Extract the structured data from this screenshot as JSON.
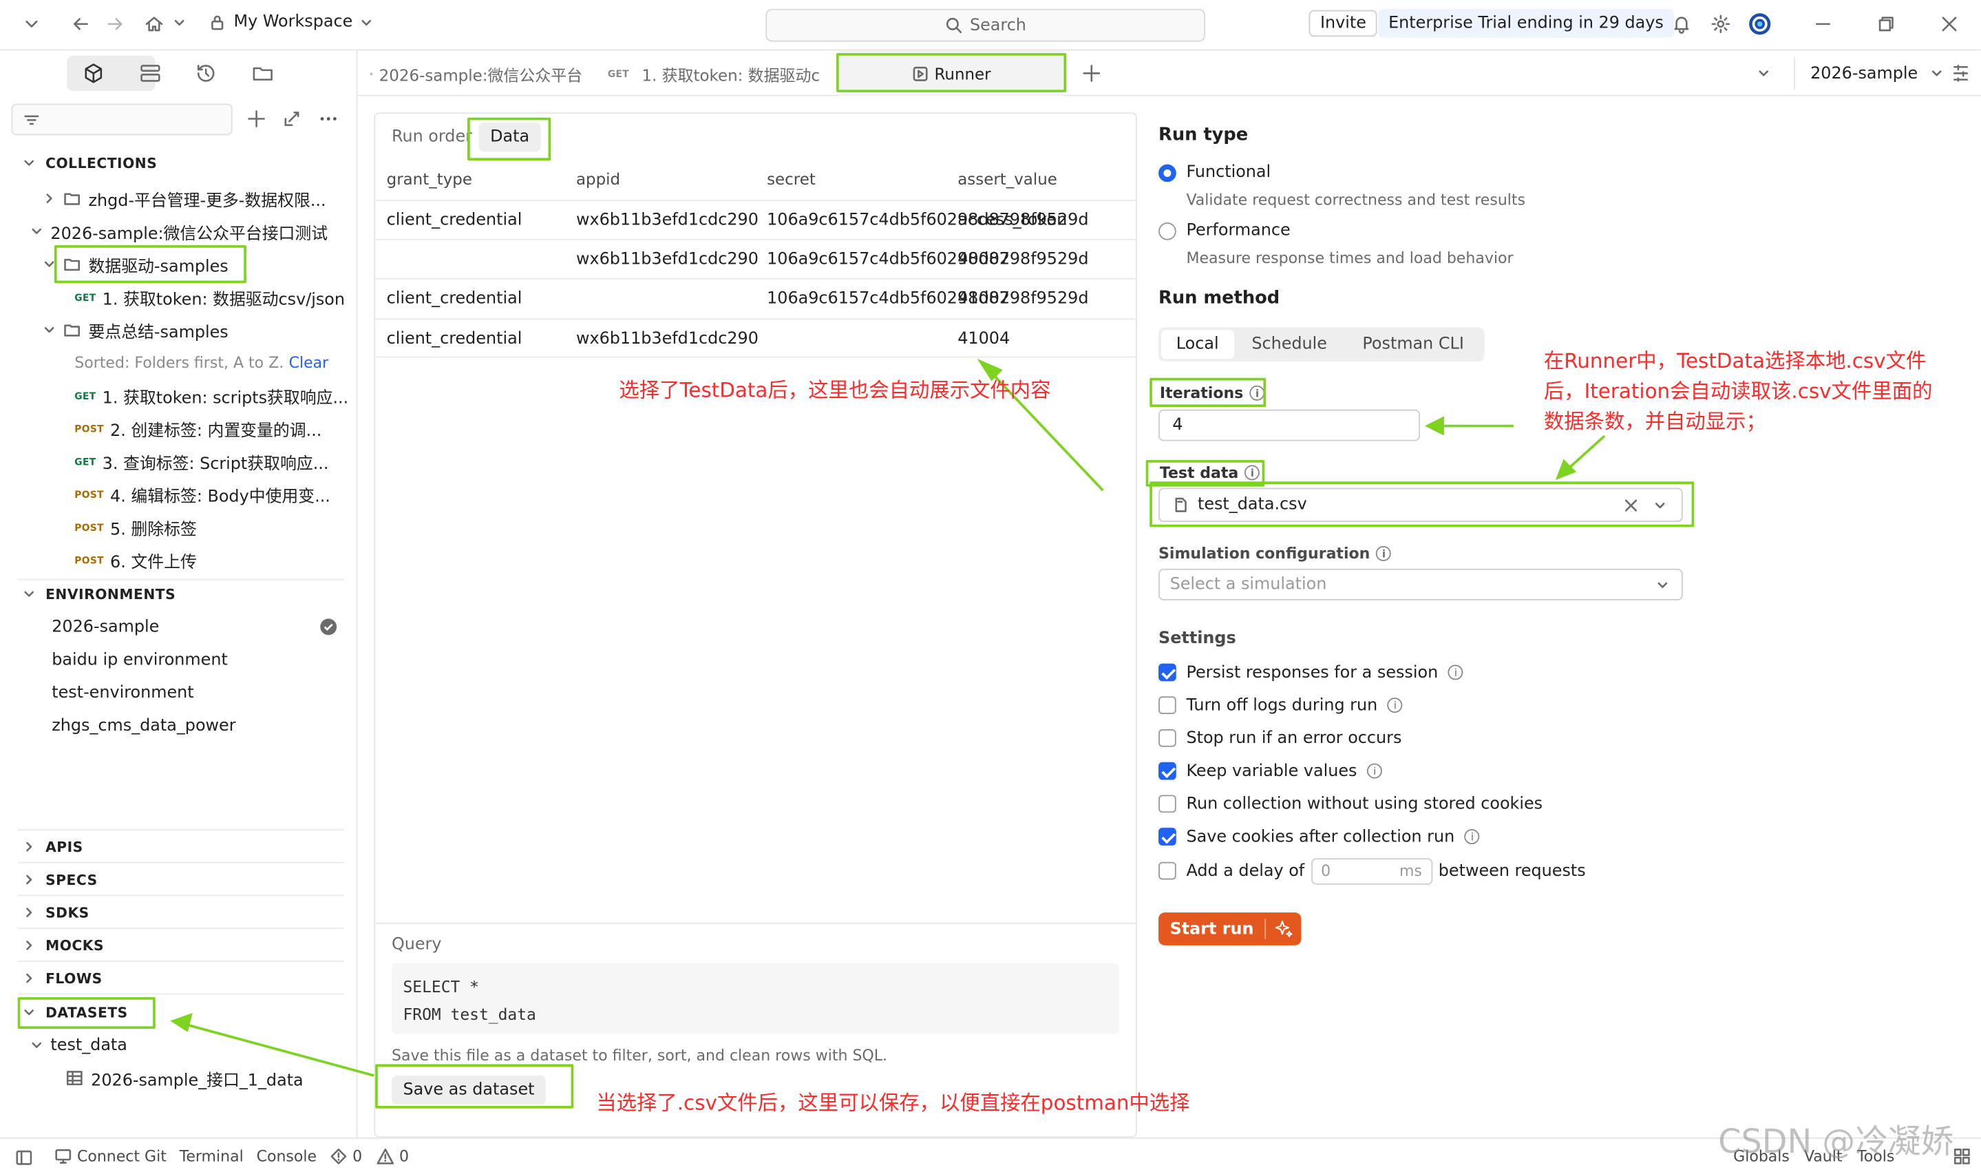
{
  "topbar": {
    "workspace": "My Workspace",
    "search_placeholder": "Search",
    "invite": "Invite",
    "trial": "Enterprise Trial ending in 29 days"
  },
  "sidebar": {
    "collections_header": "COLLECTIONS",
    "items": [
      {
        "type": "folder",
        "label": "zhgd-平台管理-更多-数据权限..."
      },
      {
        "type": "collection",
        "label": "2026-sample:微信公众平台接口测试"
      },
      {
        "type": "folder",
        "label": "数据驱动-samples"
      },
      {
        "method": "GET",
        "label": "1. 获取token: 数据驱动csv/json"
      },
      {
        "type": "folder",
        "label": "要点总结-samples"
      },
      {
        "type": "note",
        "label": "Sorted: Folders first, A to Z.",
        "link": "Clear"
      },
      {
        "method": "GET",
        "label": "1. 获取token: scripts获取响应..."
      },
      {
        "method": "POST",
        "label": "2. 创建标签: 内置变量的调..."
      },
      {
        "method": "GET",
        "label": "3. 查询标签: Script获取响应..."
      },
      {
        "method": "POST",
        "label": "4. 编辑标签: Body中使用变..."
      },
      {
        "method": "POST",
        "label": "5. 删除标签"
      },
      {
        "method": "POST",
        "label": "6. 文件上传"
      }
    ],
    "environments_header": "ENVIRONMENTS",
    "environments": [
      "2026-sample",
      "baidu ip environment",
      "test-environment",
      "zhgs_cms_data_power"
    ],
    "sections": [
      "APIS",
      "SPECS",
      "SDKS",
      "MOCKS",
      "FLOWS",
      "DATASETS"
    ],
    "datasets": {
      "name": "test_data",
      "child": "2026-sample_接口_1_data"
    }
  },
  "tabs": [
    {
      "label": "2026-sample:微信公众平台"
    },
    {
      "method": "GET",
      "label": "1. 获取token: 数据驱动csv/"
    },
    {
      "label": "Runner"
    }
  ],
  "env_selector": "2026-sample",
  "data_panel": {
    "tabs": [
      "Run order",
      "Data"
    ],
    "columns": [
      "grant_type",
      "appid",
      "secret",
      "assert_value"
    ],
    "rows": [
      [
        "client_credential",
        "wx6b11b3efd1cdc290",
        "106a9c6157c4db5f60298d8798f9529d",
        "access_token"
      ],
      [
        "",
        "wx6b11b3efd1cdc290",
        "106a9c6157c4db5f60298d8798f9529d",
        "40002"
      ],
      [
        "client_credential",
        "",
        "106a9c6157c4db5f60298d8798f9529d",
        "41002"
      ],
      [
        "client_credential",
        "wx6b11b3efd1cdc290",
        "",
        "41004"
      ]
    ],
    "query_label": "Query",
    "query_lines": [
      "SELECT *",
      "FROM test_data"
    ],
    "save_hint": "Save this file as a dataset to filter, sort, and clean rows with SQL.",
    "save_button": "Save as dataset"
  },
  "run_type": {
    "title": "Run type",
    "options": [
      {
        "label": "Functional",
        "desc": "Validate request correctness and test results",
        "selected": true
      },
      {
        "label": "Performance",
        "desc": "Measure response times and load behavior",
        "selected": false
      }
    ]
  },
  "run_method": {
    "title": "Run method",
    "options": [
      "Local",
      "Schedule",
      "Postman CLI"
    ]
  },
  "iterations": {
    "label": "Iterations",
    "value": "4"
  },
  "test_data": {
    "label": "Test data",
    "file": "test_data.csv"
  },
  "simulation": {
    "label": "Simulation configuration",
    "placeholder": "Select a simulation"
  },
  "settings": {
    "title": "Settings",
    "items": [
      {
        "label": "Persist responses for a session",
        "checked": true,
        "info": true
      },
      {
        "label": "Turn off logs during run",
        "checked": false,
        "info": true
      },
      {
        "label": "Stop run if an error occurs",
        "checked": false,
        "info": false
      },
      {
        "label": "Keep variable values",
        "checked": true,
        "info": true
      },
      {
        "label": "Run collection without using stored cookies",
        "checked": false,
        "info": false
      },
      {
        "label": "Save cookies after collection run",
        "checked": true,
        "info": true
      }
    ],
    "delay": {
      "prefix": "Add a delay of",
      "value": "0",
      "unit": "ms",
      "suffix": "between requests"
    }
  },
  "start_run": "Start run",
  "annotations": {
    "table": "选择了TestData后，这里也会自动展示文件内容",
    "iteration": [
      "在Runner中，TestData选择本地.csv文件",
      "后，Iteration会自动读取该.csv文件里面的",
      "数据条数，并自动显示；"
    ],
    "save": "当选择了.csv文件后，这里可以保存，以便直接在postman中选择"
  },
  "status": {
    "left": [
      "Connect Git",
      "Terminal",
      "Console"
    ],
    "errors": "0",
    "warnings": "0",
    "right": [
      "Globals",
      "Vault",
      "Tools"
    ],
    "watermark": "CSDN @冷凝娇"
  }
}
